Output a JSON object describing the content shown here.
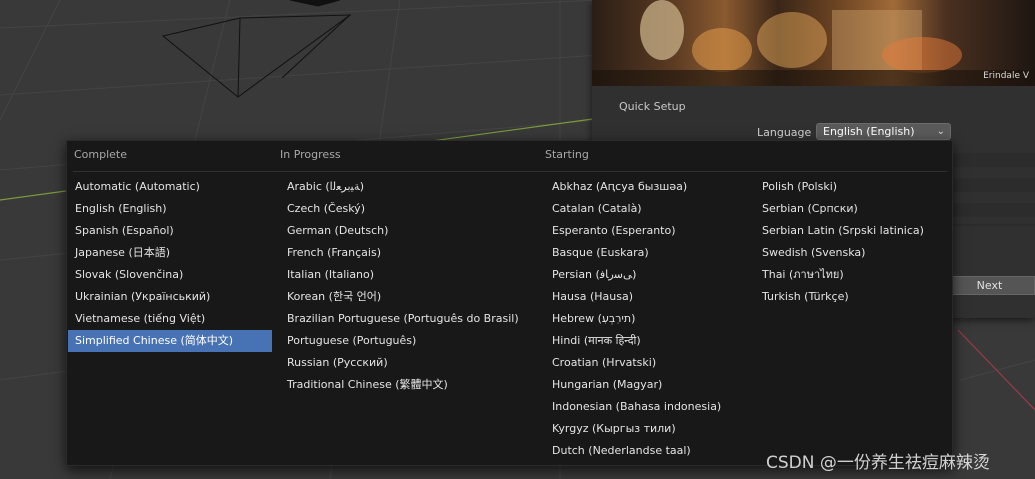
{
  "splash": {
    "credit": "Erindale V",
    "quick_setup": "Quick Setup",
    "language_label": "Language",
    "language_value": "English (English)",
    "next_label": "Next"
  },
  "menu": {
    "headers": [
      "Complete",
      "In Progress",
      "Starting"
    ],
    "complete": [
      {
        "label": "Automatic (Automatic)"
      },
      {
        "label": "English (English)"
      },
      {
        "label": "Spanish (Español)"
      },
      {
        "label": "Japanese (日本語)"
      },
      {
        "label": "Slovak (Slovenčina)"
      },
      {
        "label": "Ukrainian (Український)"
      },
      {
        "label": "Vietnamese (tiếng Việt)"
      },
      {
        "label": "Simplified Chinese (简体中文)",
        "selected": true
      }
    ],
    "in_progress": [
      {
        "label": "Arabic (ﺔﻴﺑﺮﻌﻟﺍ)"
      },
      {
        "label": "Czech (Český)"
      },
      {
        "label": "German (Deutsch)"
      },
      {
        "label": "French (Français)"
      },
      {
        "label": "Italian (Italiano)"
      },
      {
        "label": "Korean (한국 언어)"
      },
      {
        "label": "Brazilian Portuguese (Português do Brasil)"
      },
      {
        "label": "Portuguese (Português)"
      },
      {
        "label": "Russian (Русский)"
      },
      {
        "label": "Traditional Chinese (繁體中文)"
      }
    ],
    "starting": [
      {
        "label": "Abkhaz (Аԥсуа бызшәа)"
      },
      {
        "label": "Catalan (Català)"
      },
      {
        "label": "Esperanto (Esperanto)"
      },
      {
        "label": "Basque (Euskara)"
      },
      {
        "label": "Persian (ﯽﺳﺭﺎﻓ)"
      },
      {
        "label": "Hausa (Hausa)"
      },
      {
        "label": "Hebrew (תירִבְעִ)"
      },
      {
        "label": "Hindi (मानक हिन्दी)"
      },
      {
        "label": "Croatian (Hrvatski)"
      },
      {
        "label": "Hungarian (Magyar)"
      },
      {
        "label": "Indonesian (Bahasa indonesia)"
      },
      {
        "label": "Kyrgyz (Кыргыз тили)"
      },
      {
        "label": "Dutch (Nederlandse taal)"
      }
    ],
    "starting_2": [
      {
        "label": "Polish (Polski)"
      },
      {
        "label": "Serbian (Српски)"
      },
      {
        "label": "Serbian Latin (Srpski latinica)"
      },
      {
        "label": "Swedish (Svenska)"
      },
      {
        "label": "Thai (ภาษาไทย)"
      },
      {
        "label": "Turkish (Türkçe)"
      }
    ]
  },
  "watermark": "CSDN @一份养生祛痘麻辣烫",
  "colors": {
    "viewport_bg": "#393939",
    "menu_bg": "#181818",
    "selection": "#4772b3",
    "grid_line": "#444444",
    "x_axis": "#7a9a3a",
    "y_axis": "#9a3a4a"
  }
}
